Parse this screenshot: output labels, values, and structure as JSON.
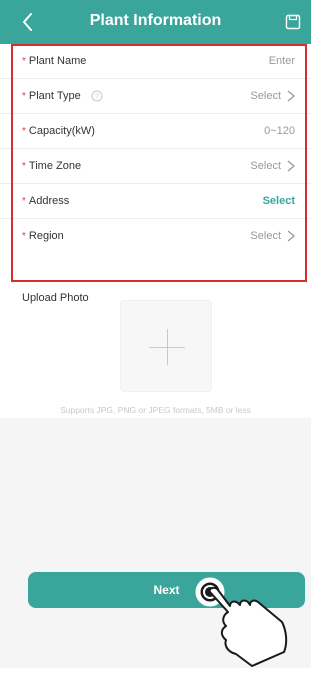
{
  "header": {
    "title": "Plant Information",
    "back_icon": "chevron-left-icon",
    "save_icon": "save-icon",
    "background": "#3aa59b"
  },
  "form": {
    "rows": [
      {
        "label": "Plant Name",
        "required": "*",
        "value": "Enter",
        "has_chevron": false,
        "has_help": false
      },
      {
        "label": "Plant Type",
        "required": "*",
        "value": "Select",
        "has_chevron": true,
        "has_help": true
      },
      {
        "label": "Capacity(kW)",
        "required": "*",
        "value": "0~120",
        "has_chevron": false,
        "has_help": false
      },
      {
        "label": "Time Zone",
        "required": "*",
        "value": "Select",
        "has_chevron": true,
        "has_help": false
      },
      {
        "label": "Address",
        "required": "*",
        "value": "Select",
        "has_chevron": false,
        "has_help": false,
        "value_color": "#3aa59b"
      },
      {
        "label": "Region",
        "required": "*",
        "value": "Select",
        "has_chevron": true,
        "has_help": false
      }
    ],
    "highlight_color": "#d32f2f"
  },
  "upload": {
    "label": "Upload Photo",
    "hint": "Supports JPG, PNG or JPEG formats, 5MB or less",
    "icon": "plus-icon"
  },
  "footer": {
    "next_label": "Next",
    "accent": "#3aa59b"
  }
}
